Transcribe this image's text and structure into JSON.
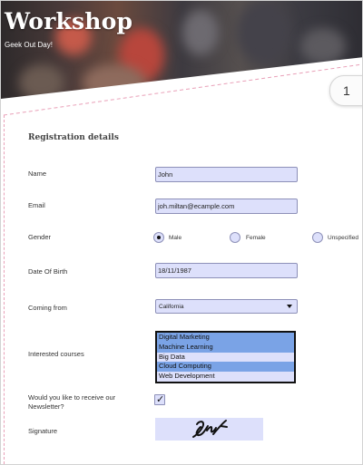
{
  "header": {
    "title": "Workshop",
    "subtitle": "Geek Out Day!",
    "page_number": "1"
  },
  "form": {
    "section_title": "Registration details",
    "name": {
      "label": "Name",
      "value": "John"
    },
    "email": {
      "label": "Email",
      "value": "joh.miltan@ecample.com"
    },
    "gender": {
      "label": "Gender",
      "options": [
        "Male",
        "Female",
        "Unspecified"
      ],
      "selected": "Male"
    },
    "dob": {
      "label": "Date Of Birth",
      "value": "18/11/1987"
    },
    "coming_from": {
      "label": "Coming from",
      "value": "California"
    },
    "courses": {
      "label": "Interested courses",
      "options": [
        {
          "text": "Digital Marketing",
          "selected": true
        },
        {
          "text": "Machine Learning",
          "selected": true
        },
        {
          "text": "Big Data",
          "selected": false
        },
        {
          "text": "Cloud Computing",
          "selected": true
        },
        {
          "text": "Web Development",
          "selected": false
        }
      ]
    },
    "newsletter": {
      "label": "Would you like to receive our Newsletter?",
      "checked": true,
      "mark": "✓"
    },
    "signature": {
      "label": "Signature"
    }
  },
  "colors": {
    "field_bg": "#dde0fb",
    "field_border": "#8d90b8",
    "selected_option": "#7aa3e6",
    "dashed_border": "#e9a0b8"
  }
}
